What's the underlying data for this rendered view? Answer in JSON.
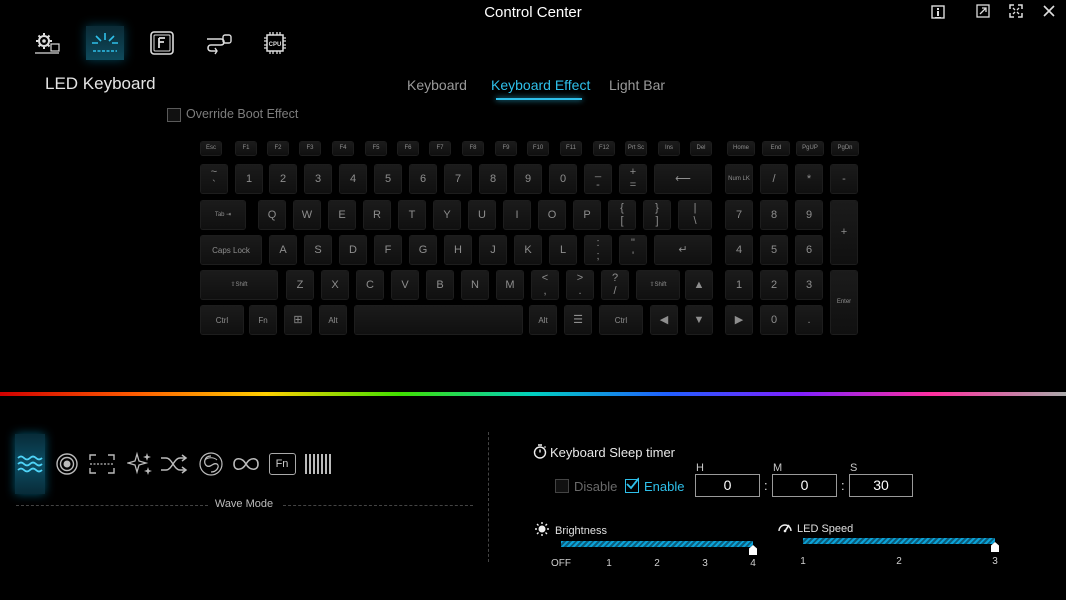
{
  "window": {
    "title": "Control Center"
  },
  "page": {
    "title": "LED Keyboard"
  },
  "tabs": [
    {
      "label": "Keyboard"
    },
    {
      "label": "Keyboard Effect"
    },
    {
      "label": "Light Bar"
    }
  ],
  "override": {
    "label": "Override Boot Effect"
  },
  "keyboard": {
    "row0": [
      "Esc",
      "F1",
      "F2",
      "F3",
      "F4",
      "F5",
      "F6",
      "F7",
      "F8",
      "F9",
      "F10",
      "F11",
      "F12",
      "Prt Sc",
      "Ins",
      "Del",
      "Home",
      "End",
      "PgUP",
      "PgDn"
    ],
    "row1": [
      [
        "~",
        "`"
      ],
      [
        "1"
      ],
      [
        "2"
      ],
      [
        "3"
      ],
      [
        "4"
      ],
      [
        "5"
      ],
      [
        "6"
      ],
      [
        "7"
      ],
      [
        "8"
      ],
      [
        "9"
      ],
      [
        "0"
      ],
      [
        "_",
        "-"
      ],
      [
        "+",
        "="
      ],
      [
        "⟵"
      ],
      [
        "Num LK"
      ],
      [
        "/"
      ],
      [
        "*"
      ],
      [
        "-"
      ]
    ],
    "row2": [
      [
        "Tab ⇥"
      ],
      [
        "Q"
      ],
      [
        "W"
      ],
      [
        "E"
      ],
      [
        "R"
      ],
      [
        "T"
      ],
      [
        "Y"
      ],
      [
        "U"
      ],
      [
        "I"
      ],
      [
        "O"
      ],
      [
        "P"
      ],
      [
        "{",
        "["
      ],
      [
        "}",
        "]"
      ],
      [
        "|",
        "\\"
      ],
      [
        "7"
      ],
      [
        "8"
      ],
      [
        "9"
      ],
      [
        "+"
      ]
    ],
    "row3": [
      [
        "Caps Lock"
      ],
      [
        "A"
      ],
      [
        "S"
      ],
      [
        "D"
      ],
      [
        "F"
      ],
      [
        "G"
      ],
      [
        "H"
      ],
      [
        "J"
      ],
      [
        "K"
      ],
      [
        "L"
      ],
      [
        ":",
        ";"
      ],
      [
        "\"",
        "'"
      ],
      [
        "↵"
      ],
      [
        "4"
      ],
      [
        "5"
      ],
      [
        "6"
      ]
    ],
    "row4": [
      [
        "⇧Shift"
      ],
      [
        "Z"
      ],
      [
        "X"
      ],
      [
        "C"
      ],
      [
        "V"
      ],
      [
        "B"
      ],
      [
        "N"
      ],
      [
        "M"
      ],
      [
        "<",
        ","
      ],
      [
        ">",
        "."
      ],
      [
        "?",
        "/"
      ],
      [
        "⇧Shift"
      ],
      [
        "▲"
      ],
      [
        "1"
      ],
      [
        "2"
      ],
      [
        "3"
      ],
      [
        "Enter"
      ]
    ],
    "row5": [
      [
        "Ctrl"
      ],
      [
        "Fn"
      ],
      [
        "⊞"
      ],
      [
        "Alt"
      ],
      [
        " "
      ],
      [
        "Alt"
      ],
      [
        "☰"
      ],
      [
        "Ctrl"
      ],
      [
        "◀"
      ],
      [
        "▼"
      ],
      [
        "▶"
      ],
      [
        "0"
      ],
      [
        "."
      ]
    ]
  },
  "effects": {
    "selected_label": "Wave Mode",
    "modes": [
      "wave-icon",
      "ripple-icon",
      "scan-icon",
      "sparkle-icon",
      "random-icon",
      "snake-icon",
      "infinity-icon",
      "fn-icon",
      "bars-icon"
    ],
    "fn_label": "Fn"
  },
  "sleep": {
    "title": "Keyboard Sleep timer",
    "disable_label": "Disable",
    "enable_label": "Enable",
    "h_label": "H",
    "m_label": "M",
    "s_label": "S",
    "hours": "0",
    "minutes": "0",
    "seconds": "30",
    "colon": ":"
  },
  "brightness": {
    "label": "Brightness",
    "ticks": [
      "OFF",
      "1",
      "2",
      "3",
      "4"
    ],
    "value": 4,
    "max": 4
  },
  "speed": {
    "label": "LED Speed",
    "ticks": [
      "1",
      "2",
      "3"
    ],
    "value": 3,
    "max": 3
  },
  "colors": {
    "accent": "#2fc0ea",
    "background": "#000000"
  }
}
